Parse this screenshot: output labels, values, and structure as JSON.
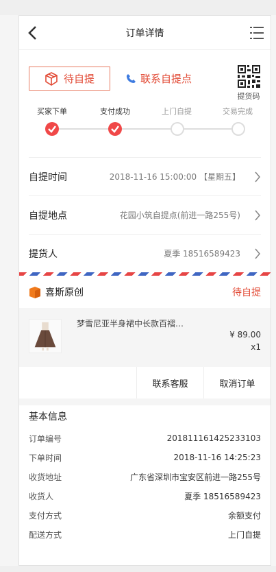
{
  "header": {
    "title": "订单详情"
  },
  "status": {
    "label": "待自提",
    "contact_label": "联系自提点",
    "qr_label": "提货码"
  },
  "progress": {
    "steps": [
      {
        "label": "买家下单",
        "done": true
      },
      {
        "label": "支付成功",
        "done": true
      },
      {
        "label": "上门自提",
        "done": false
      },
      {
        "label": "交易完成",
        "done": false
      }
    ]
  },
  "pickup": {
    "rows": [
      {
        "key": "自提时间",
        "value": "2018-11-16 15:00:00 【星期五】"
      },
      {
        "key": "自提地点",
        "value": "花园小筑自提点(前进一路255号)"
      },
      {
        "key": "提货人",
        "value": "夏季  18516589423"
      }
    ]
  },
  "shop": {
    "name": "喜斯原创",
    "status": "待自提"
  },
  "goods": {
    "name": "梦雪尼亚半身裙中长款百褶…",
    "price": "¥ 89.00",
    "qty": "x1"
  },
  "actions": {
    "service": "联系客服",
    "cancel": "取消订单"
  },
  "basic": {
    "title": "基本信息",
    "rows": [
      {
        "key": "订单编号",
        "value": "201811161425233103"
      },
      {
        "key": "下单时间",
        "value": "2018-11-16 14:25:23"
      },
      {
        "key": "收货地址",
        "value": "广东省深圳市宝安区前进一路255号"
      },
      {
        "key": "收货人",
        "value": "夏季  18516589423"
      },
      {
        "key": "支付方式",
        "value": "余额支付"
      },
      {
        "key": "配送方式",
        "value": "上门自提"
      }
    ]
  },
  "colors": {
    "accent": "#e24a35",
    "progress_done": "#f04848",
    "progress_pending": "#dddddd"
  }
}
